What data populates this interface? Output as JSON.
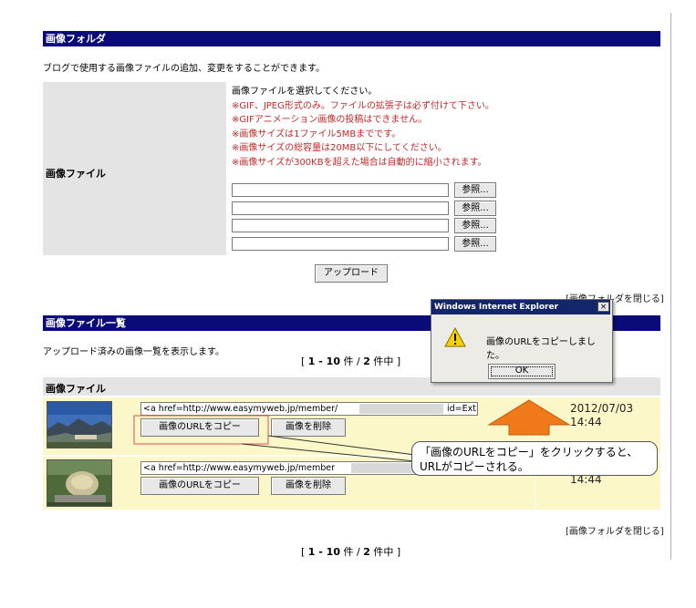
{
  "folder": {
    "header_title": "画像フォルダ",
    "description": "ブログで使用する画像ファイルの追加、変更をすることができます。",
    "file_label": "画像ファイル",
    "notes": {
      "intro": "画像ファイルを選択してください。",
      "rules": [
        "※GIF、JPEG形式のみ。ファイルの拡張子は必ず付けて下さい。",
        "※GIFアニメーション画像の投稿はできません。",
        "※画像サイズは1ファイル5MBまでです。",
        "※画像サイズの総容量は20MB以下にしてください。",
        "※画像サイズが300KBを超えた場合は自動的に縮小されます。"
      ]
    },
    "inputs": [
      {
        "value": "",
        "browse_label": "参照..."
      },
      {
        "value": "",
        "browse_label": "参照..."
      },
      {
        "value": "",
        "browse_label": "参照..."
      },
      {
        "value": "",
        "browse_label": "参照..."
      }
    ],
    "upload_label": "アップロード",
    "close_link": "[画像フォルダを閉じる]"
  },
  "list": {
    "header_title": "画像ファイル一覧",
    "description": "アップロード済みの画像一覧を表示します。",
    "pager": {
      "open": "[",
      "range": "1 - 10",
      "unit": "件",
      "sep": "/",
      "total": "2",
      "suffix": "件中",
      "close": "]"
    },
    "column_header": "画像ファイル",
    "rows": [
      {
        "url_start": "<a href=http://www.easymyweb.jp/member/",
        "url_end": "id=ExtImg",
        "copy_label": "画像のURLをコピー",
        "delete_label": "画像を削除",
        "date": "2012/07/03",
        "time": "14:44"
      },
      {
        "url_start": "<a href=http://www.easymyweb.jp/member",
        "url_end": "",
        "copy_label": "画像のURLをコピー",
        "delete_label": "画像を削除",
        "date": "",
        "time": "14:44"
      }
    ],
    "close_link": "[画像フォルダを閉じる]"
  },
  "dialog": {
    "title": "Windows Internet Explorer",
    "close_glyph": "×",
    "icon": "warning-icon",
    "message": "画像のURLをコピーしました。",
    "ok_label": "OK"
  },
  "callout": {
    "line1": "「画像のURLをコピー」をクリックすると、",
    "line2": "URLがコピーされる。"
  },
  "colors": {
    "header_bar": "#0a0a78",
    "row_bg": "#fbf7c8",
    "notes_red": "#c62828",
    "arrow": "#f07a1a",
    "highlight_box": "#e05050"
  }
}
